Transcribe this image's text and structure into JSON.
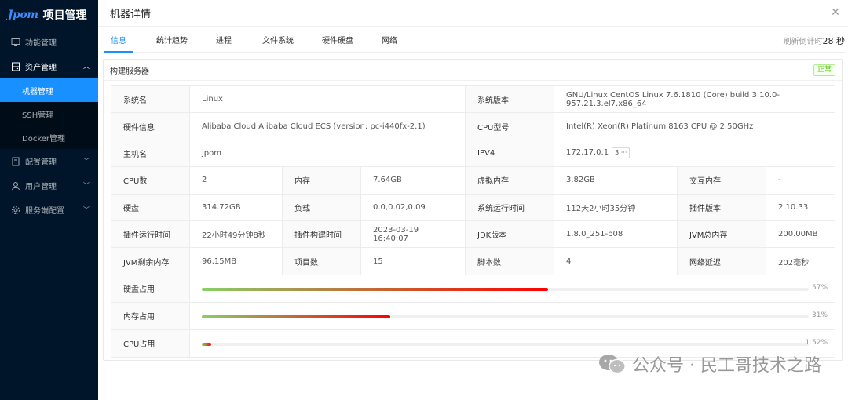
{
  "app": {
    "logo_mark": "Jpom",
    "logo_text": "项目管理"
  },
  "sidebar": {
    "items": [
      {
        "label": "功能管理",
        "icon": "monitor-icon",
        "expandable": false
      },
      {
        "label": "资产管理",
        "icon": "hdd-icon",
        "expandable": true,
        "expanded": true
      },
      {
        "label": "配置管理",
        "icon": "settings-doc-icon",
        "expandable": true
      },
      {
        "label": "用户管理",
        "icon": "user-icon",
        "expandable": true
      },
      {
        "label": "服务端配置",
        "icon": "gear-icon",
        "expandable": true
      }
    ],
    "subitems": [
      {
        "label": "机器管理",
        "active": true
      },
      {
        "label": "SSH管理",
        "active": false
      },
      {
        "label": "Docker管理",
        "active": false
      }
    ]
  },
  "drawer": {
    "title": "机器详情",
    "close_glyph": "✕"
  },
  "tabs": [
    {
      "label": "信息",
      "active": true
    },
    {
      "label": "统计趋势",
      "active": false
    },
    {
      "label": "进程",
      "active": false
    },
    {
      "label": "文件系统",
      "active": false
    },
    {
      "label": "硬件硬盘",
      "active": false
    },
    {
      "label": "网络",
      "active": false
    }
  ],
  "refresh": {
    "prefix": "刷新倒计时",
    "value": "28",
    "suffix": " 秒"
  },
  "card": {
    "title": "构建服务器",
    "status": "正常"
  },
  "info": {
    "os_name_label": "系统名",
    "os_name": "Linux",
    "os_version_label": "系统版本",
    "os_version": "GNU/Linux CentOS Linux 7.6.1810 (Core) build 3.10.0-957.21.3.el7.x86_64",
    "hardware_label": "硬件信息",
    "hardware": "Alibaba Cloud Alibaba Cloud ECS (version: pc-i440fx-2.1)",
    "cpu_model_label": "CPU型号",
    "cpu_model": "Intel(R) Xeon(R) Platinum 8163 CPU @ 2.50GHz",
    "hostname_label": "主机名",
    "hostname": "jpom",
    "ipv4_label": "IPV4",
    "ipv4": "172.17.0.1",
    "ipv4_more": "3 ···",
    "cpu_count_label": "CPU数",
    "cpu_count": "2",
    "memory_label": "内存",
    "memory": "7.64GB",
    "virtual_memory_label": "虚拟内存",
    "virtual_memory": "3.82GB",
    "swap_label": "交互内存",
    "swap": "-",
    "disk_label": "硬盘",
    "disk": "314.72GB",
    "load_label": "负载",
    "load": "0.0,0.02,0.09",
    "uptime_label": "系统运行时间",
    "uptime": "112天2小时35分钟",
    "plugin_version_label": "插件版本",
    "plugin_version": "2.10.33",
    "plugin_uptime_label": "插件运行时间",
    "plugin_uptime": "22小时49分钟8秒",
    "plugin_build_label": "插件构建时间",
    "plugin_build": "2023-03-19 16:40:07",
    "jdk_label": "JDK版本",
    "jdk": "1.8.0_251-b08",
    "jvm_total_label": "JVM总内存",
    "jvm_total": "200.00MB",
    "jvm_free_label": "JVM剩余内存",
    "jvm_free": "96.15MB",
    "project_count_label": "项目数",
    "project_count": "15",
    "script_count_label": "脚本数",
    "script_count": "4",
    "latency_label": "网络延迟",
    "latency": "202毫秒"
  },
  "usage": [
    {
      "label": "硬盘占用",
      "percent": 57,
      "text": "57%"
    },
    {
      "label": "内存占用",
      "percent": 31,
      "text": "31%"
    },
    {
      "label": "CPU占用",
      "percent": 1.52,
      "text": "1.52%"
    }
  ],
  "colors": {
    "accent": "#1890ff",
    "bar_start": "#87d068",
    "bar_end": "#ff0000",
    "sidebar_bg": "#001529"
  },
  "watermark": {
    "text": "公众号 · 民工哥技术之路",
    "icon": "wechat-icon"
  }
}
